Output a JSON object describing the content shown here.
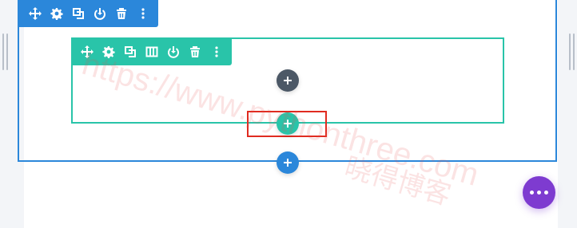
{
  "colors": {
    "section_accent": "#2b87da",
    "row_accent": "#29c4a9",
    "module_add": "#4c5866",
    "highlight": "#e02b20",
    "fab": "#7e3bd0"
  },
  "section_toolbar": {
    "icons": [
      "move-icon",
      "settings-gear-icon",
      "duplicate-icon",
      "save-to-library-icon",
      "delete-trash-icon",
      "more-vertical-icon"
    ]
  },
  "row_toolbar": {
    "icons": [
      "move-icon",
      "settings-gear-icon",
      "duplicate-icon",
      "columns-icon",
      "save-to-library-icon",
      "delete-trash-icon",
      "more-vertical-icon"
    ]
  },
  "buttons": {
    "add_module": "plus-icon",
    "add_row": "plus-icon",
    "add_section": "plus-icon",
    "page_settings": "more-horizontal-icon"
  },
  "watermark": {
    "url": "https://www.pythonthree.com",
    "cn": "晓得博客"
  }
}
